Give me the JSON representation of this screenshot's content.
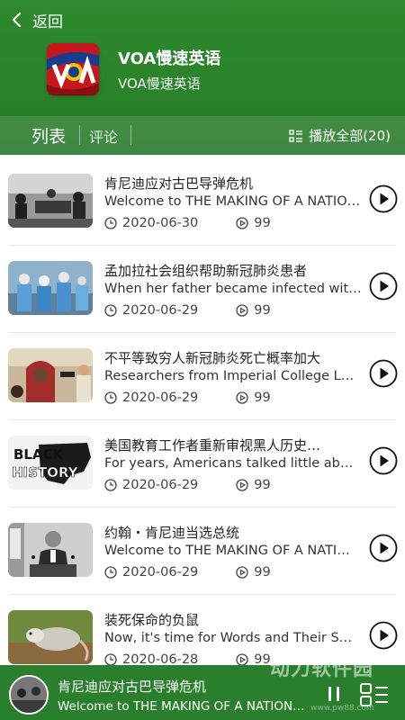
{
  "header": {
    "back_label": "返回",
    "app_title": "VOA慢速英语",
    "app_subtitle": "VOA慢速英语",
    "logo_text": "VOA",
    "colors": {
      "header_green": "#2a8229",
      "accent_red": "#c8161d"
    }
  },
  "tabs": [
    {
      "label": "列表"
    },
    {
      "label": "评论"
    }
  ],
  "play_all_label": "播放全部(20)",
  "items": [
    {
      "title": "肯尼迪应对古巴导弹危机",
      "desc": "Welcome to THE MAKING OF A NATION …",
      "date": "2020-06-30",
      "plays": "99"
    },
    {
      "title": "孟加拉社会组织帮助新冠肺炎患者",
      "desc": "When her father became infected with…",
      "date": "2020-06-29",
      "plays": "99"
    },
    {
      "title": "不平等致穷人新冠肺炎死亡概率加大",
      "desc": "Researchers from Imperial College L…",
      "date": "2020-06-29",
      "plays": "99"
    },
    {
      "title": "美国教育工作者重新审视黑人历史…",
      "desc": "For years, Americans talked little ab…",
      "date": "2020-06-29",
      "plays": "99"
    },
    {
      "title": "约翰・肯尼迪当选总统",
      "desc": "Welcome to THE MAKING OF A NATI…",
      "date": "2020-06-29",
      "plays": "99"
    },
    {
      "title": "装死保命的负鼠",
      "desc": "Now, it's time for Words and Their S…",
      "date": "2020-06-28",
      "plays": "99"
    }
  ],
  "thumb_art": {
    "t4_line1": "BLACK",
    "t4_line2": "HISTORY"
  },
  "player": {
    "title": "肯尼迪应对古巴导弹危机",
    "desc": "Welcome to THE MAKING OF A NATION…"
  },
  "watermark": {
    "main": "动力软件园",
    "sub": "www.pw88.com"
  }
}
